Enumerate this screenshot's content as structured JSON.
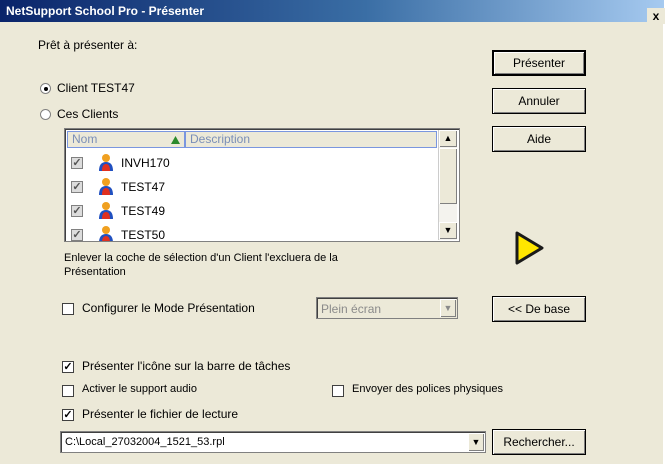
{
  "window": {
    "title": "NetSupport School Pro - Présenter",
    "close_label": "x"
  },
  "ready_label": "Prêt à présenter à:",
  "radio_client": {
    "label": "Client TEST47",
    "selected": true
  },
  "radio_clients": {
    "label": "Ces Clients",
    "selected": false
  },
  "list": {
    "columns": {
      "name": "Nom",
      "description": "Description"
    },
    "rows": [
      {
        "name": "INVH170",
        "checked": true
      },
      {
        "name": "TEST47",
        "checked": true
      },
      {
        "name": "TEST49",
        "checked": true
      },
      {
        "name": "TEST50",
        "checked": true
      }
    ]
  },
  "hint_line1": "Enlever la coche de sélection d'un Client l'excluera de la",
  "hint_line2": "Présentation",
  "config_mode": {
    "label": "Configurer le Mode Présentation",
    "checked": false,
    "combo_value": "Plein écran"
  },
  "buttons": {
    "present": "Présenter",
    "cancel": "Annuler",
    "help": "Aide",
    "basic": "<< De base",
    "browse": "Rechercher..."
  },
  "options": {
    "taskbar": {
      "label": "Présenter l'icône sur la barre de tâches",
      "checked": true
    },
    "audio": {
      "label": "Activer le support audio",
      "checked": false
    },
    "fonts": {
      "label": "Envoyer des polices physiques",
      "checked": false
    },
    "playback": {
      "label": "Présenter le fichier de lecture",
      "checked": true
    }
  },
  "file_path": "C:\\Local_27032004_1521_53.rpl",
  "colors": {
    "title_start": "#0a246a",
    "play_arrow": "#ffe600"
  },
  "icons": {
    "play": "play-arrow-icon",
    "user": "user-icon",
    "sort": "sort-up-icon"
  }
}
